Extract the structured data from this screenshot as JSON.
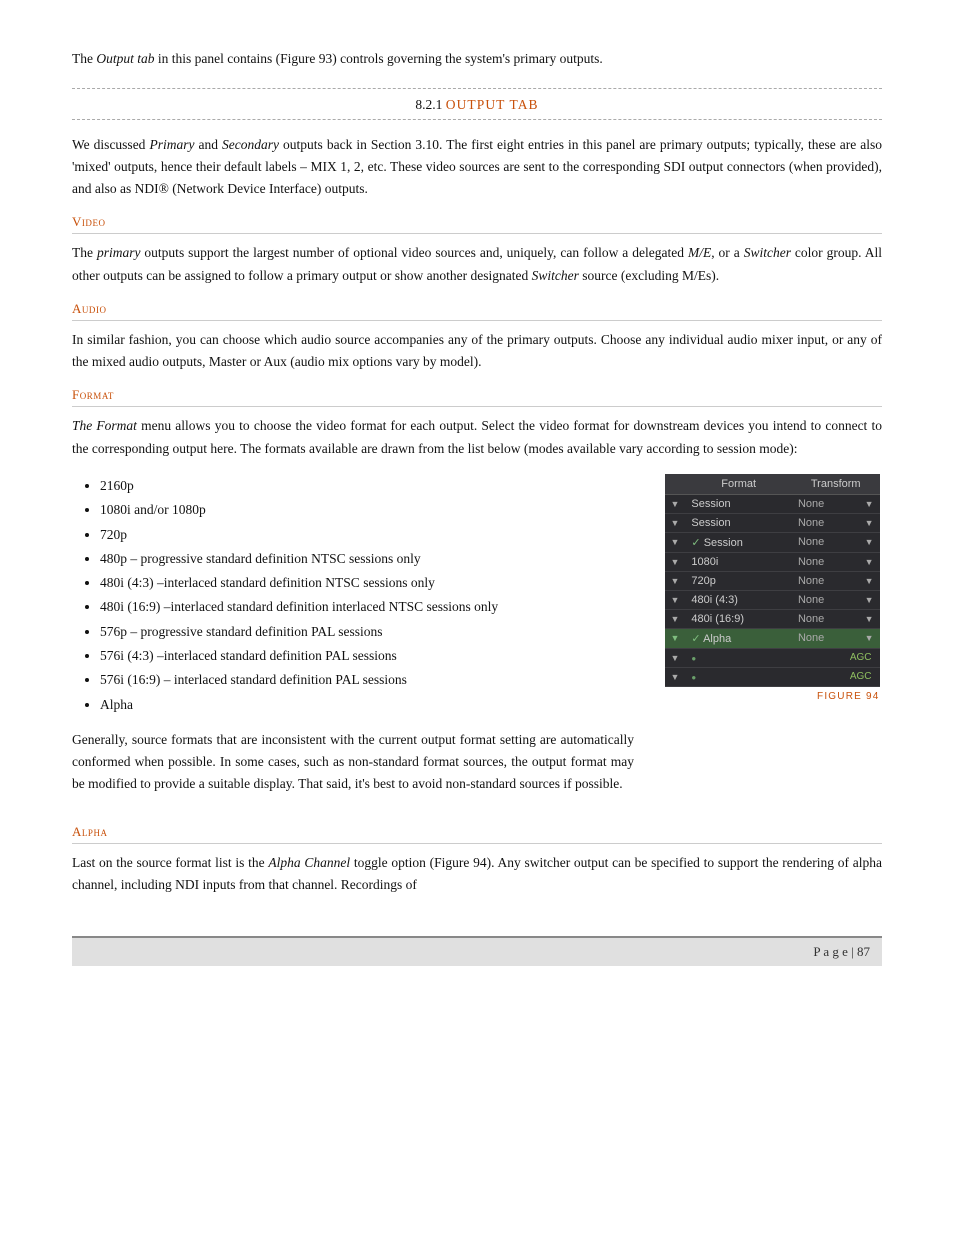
{
  "intro": {
    "text_before_italic": "The ",
    "italic": "Output tab",
    "text_after": " in this panel contains (Figure 93) controls governing the system's primary outputs."
  },
  "section_821": {
    "number": "8.2.1",
    "name": "OUTPUT TAB"
  },
  "main_para": "We discussed Primary and Secondary outputs back in Section 3.10. The first eight entries in this panel are primary outputs; typically, these are also 'mixed' outputs, hence their default labels – MIX 1, 2, etc.  These video sources are sent to the corresponding SDI output connectors (when provided), and also as NDI® (Network Device Interface) outputs.",
  "subsections": {
    "video": {
      "label": "Video",
      "para": "The primary outputs support the largest number of optional video sources and, uniquely, can follow a delegated M/E, or a Switcher color group.  All other outputs can be assigned to follow a primary output or show another designated Switcher source (excluding M/Es)."
    },
    "audio": {
      "label": "Audio",
      "para": "In similar fashion, you can choose which audio source accompanies any of the primary outputs.  Choose any individual audio mixer input, or any of the mixed audio outputs, Master or Aux (audio mix options vary by model)."
    },
    "format": {
      "label": "Format",
      "para": "The Format menu allows you to choose the video format for each output. Select the video format for downstream devices you intend to connect to the corresponding output here. The formats available are drawn from the list below (modes available vary according to session mode):"
    }
  },
  "bullet_list": [
    "2160p",
    "1080i and/or 1080p",
    "720p",
    "480p – progressive standard definition NTSC sessions only",
    "480i (4:3) –interlaced standard definition NTSC sessions only",
    "480i (16:9) –interlaced standard definition interlaced NTSC sessions only",
    "576p – progressive standard definition PAL sessions",
    "576i (4:3) –interlaced standard definition PAL sessions",
    "576i (16:9) – interlaced standard definition PAL sessions",
    "Alpha"
  ],
  "after_list_para": "Generally, source formats that are inconsistent with the current output format setting are automatically conformed when possible.  In some cases, such as non-standard format sources, the output format may be modified to provide a suitable display.  That said, it's best to avoid non-standard sources if possible.",
  "figure94": {
    "label": "FIGURE 94",
    "columns": [
      "Format",
      "Transform"
    ],
    "rows": [
      {
        "arrow": "▼",
        "format": "Session",
        "has_arrow": true,
        "none": "None",
        "none_arrow": "▼",
        "highlighted": false
      },
      {
        "arrow": "▼",
        "format": "Session",
        "has_arrow": true,
        "none": "None",
        "none_arrow": "▼",
        "highlighted": false
      },
      {
        "arrow": "▼",
        "format": "✓ Session",
        "has_arrow": false,
        "none": "None",
        "none_arrow": "▼",
        "highlighted": false
      },
      {
        "arrow": "▼",
        "format": "1080i",
        "has_arrow": false,
        "none": "None",
        "none_arrow": "▼",
        "highlighted": false
      },
      {
        "arrow": "▼",
        "format": "720p",
        "has_arrow": false,
        "none": "None",
        "none_arrow": "▼",
        "highlighted": false
      },
      {
        "arrow": "▼",
        "format": "480i (4:3)",
        "has_arrow": false,
        "none": "None",
        "none_arrow": "▼",
        "highlighted": false
      },
      {
        "arrow": "▼",
        "format": "480i (16:9)",
        "has_arrow": false,
        "none": "None",
        "none_arrow": "▼",
        "highlighted": false
      },
      {
        "arrow": "▼",
        "format": "✓ Alpha",
        "has_arrow": false,
        "none": "None",
        "none_arrow": "▼",
        "highlighted": true
      },
      {
        "arrow": "▼",
        "format": "",
        "has_arrow": false,
        "none": "",
        "none_arrow": "",
        "agc": "AGC",
        "highlighted": false,
        "dot": "●"
      },
      {
        "arrow": "▼",
        "format": "",
        "has_arrow": false,
        "none": "",
        "none_arrow": "",
        "agc": "AGC",
        "highlighted": false,
        "dot": "●"
      }
    ]
  },
  "alpha_section": {
    "label": "Alpha",
    "para_before": "Last on the source format list is the ",
    "italic": "Alpha Channel",
    "para_after": " toggle option (Figure 94).  Any switcher output can be specified to support the rendering of alpha channel, including NDI inputs from that channel.  Recordings of"
  },
  "footer": {
    "page_label": "P a g e  | 87"
  }
}
